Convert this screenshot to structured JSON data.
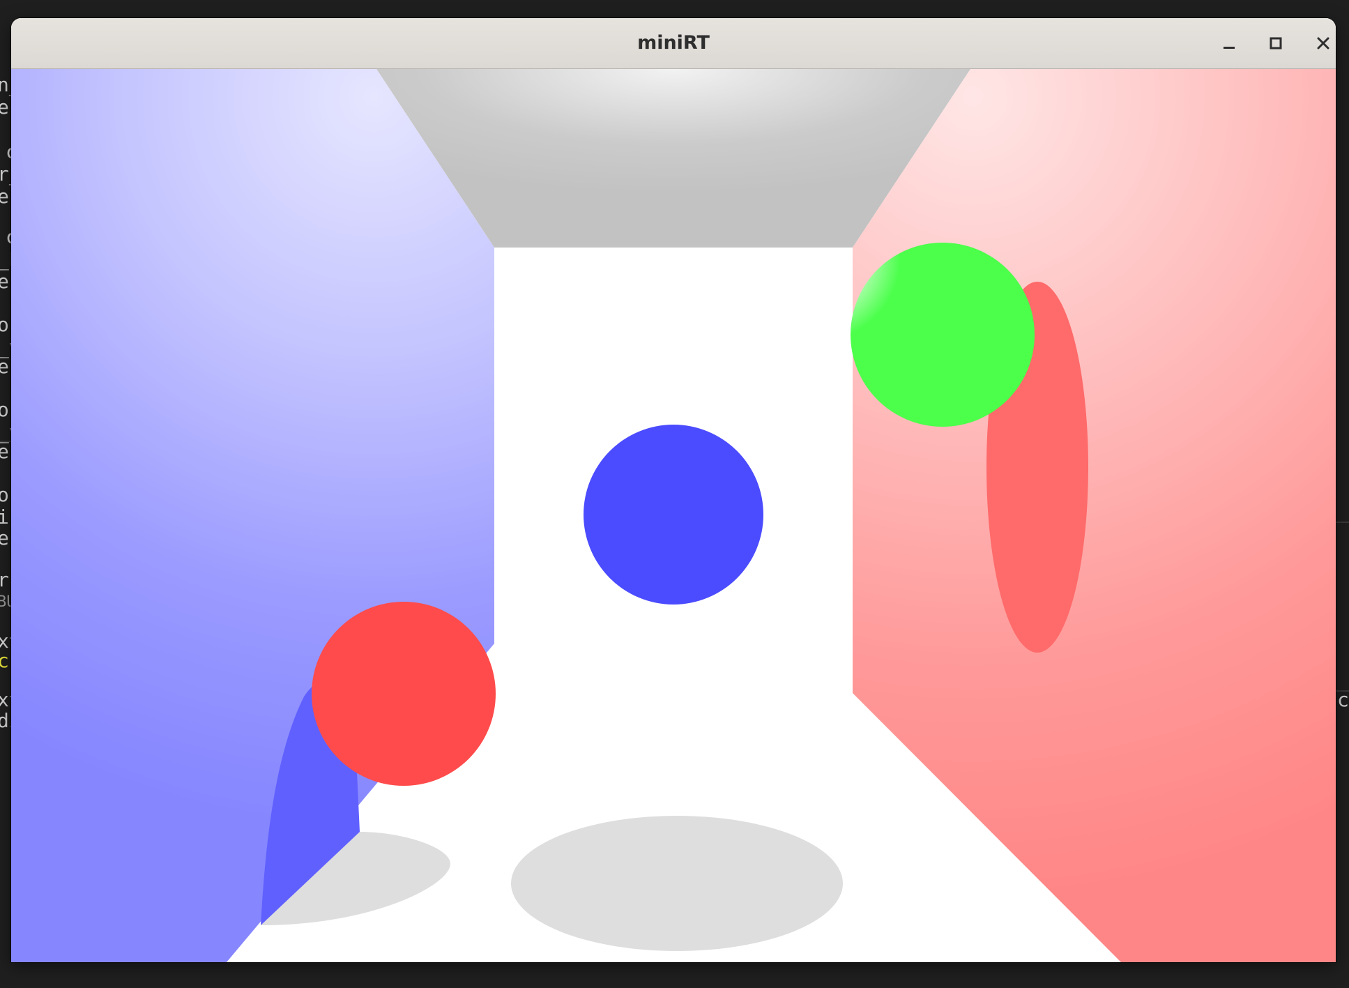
{
  "window": {
    "title": "miniRT",
    "buttons": {
      "minimize": "minimize-icon",
      "maximize": "maximize-icon",
      "close": "close-icon"
    }
  },
  "scene": {
    "background": "#ffffff",
    "ceiling_color": "#c4c4c4",
    "left_wall_color": "#8a8aff",
    "right_wall_color": "#ff8a8a",
    "floor_color": "#ffffff",
    "shadow_color": "#dedede",
    "spheres": [
      {
        "name": "blue",
        "color": "#4b4bff"
      },
      {
        "name": "green",
        "color": "#4bff4b"
      },
      {
        "name": "red",
        "color": "#ff4b4b"
      }
    ]
  },
  "terminal_fragments": {
    "left": [
      "n_",
      "er",
      "c",
      "r_",
      "er",
      "c",
      "_L",
      "er",
      "o",
      "_v",
      "er",
      "o",
      "_v",
      "er",
      "o",
      "ir",
      "er",
      "r",
      "BU",
      "xt",
      "c",
      "xt",
      "di"
    ],
    "right": [
      "c,"
    ]
  }
}
